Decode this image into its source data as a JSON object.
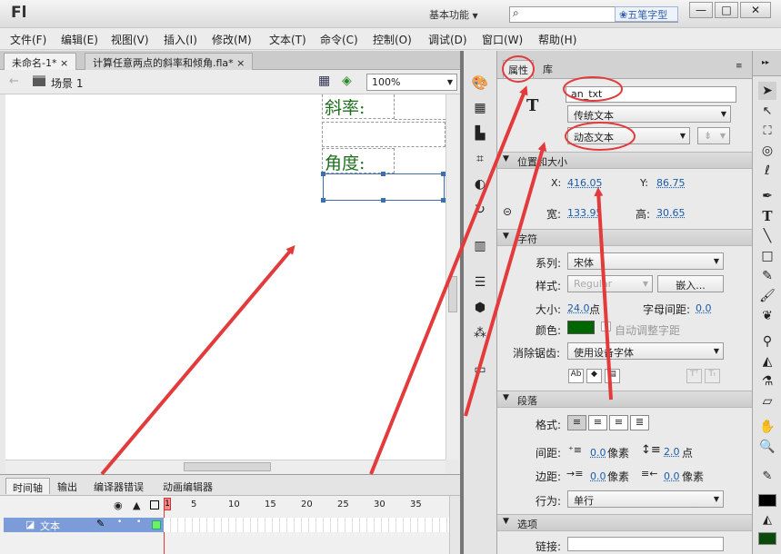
{
  "app": {
    "logo": "Fl",
    "workspace": "基本功能",
    "ime": "五笔字型",
    "win_min": "—",
    "win_max": "□",
    "win_close": "✕"
  },
  "menu": [
    "文件(F)",
    "编辑(E)",
    "视图(V)",
    "插入(I)",
    "修改(M)",
    "文本(T)",
    "命令(C)",
    "控制(O)",
    "调试(D)",
    "窗口(W)",
    "帮助(H)"
  ],
  "doc_tabs": [
    {
      "label": "未命名-1*",
      "close": "×"
    },
    {
      "label": "计算任意两点的斜率和倾角.fla*",
      "close": "×"
    }
  ],
  "scene": {
    "name": "场景 1",
    "zoom": "100%"
  },
  "stage": {
    "label1": "斜率:",
    "label2": "角度:"
  },
  "timeline": {
    "tabs": [
      "时间轴",
      "输出",
      "编译器错误",
      "动画编辑器"
    ],
    "frames": [
      "1",
      "5",
      "10",
      "15",
      "20",
      "25",
      "30",
      "35"
    ],
    "layer": "文本"
  },
  "props": {
    "tab_props": "属性",
    "tab_lib": "库",
    "type_icon": "T",
    "instance_name": "an_txt",
    "engine": "传统文本",
    "text_type": "动态文本",
    "sec_pos": "位置和大小",
    "x_label": "X:",
    "x_val": "416.05",
    "y_label": "Y:",
    "y_val": "86.75",
    "w_label": "宽:",
    "w_val": "133.95",
    "h_label": "高:",
    "h_val": "30.65",
    "sec_char": "字符",
    "family_label": "系列:",
    "family": "宋体",
    "style_label": "样式:",
    "style": "Regular",
    "embed": "嵌入...",
    "size_label": "大小:",
    "size": "24.0",
    "size_unit": "点",
    "spacing_label": "字母间距:",
    "spacing": "0.0",
    "color_label": "颜色:",
    "color": "#006600",
    "auto_kern": "自动调整字距",
    "aa_label": "消除锯齿:",
    "aa": "使用设备字体",
    "sec_para": "段落",
    "format_label": "格式:",
    "gap_label": "间距:",
    "indent": "0.0",
    "indent_unit": "像素",
    "line_spacing": "2.0",
    "line_unit": "点",
    "margin_label": "边距:",
    "left_margin": "0.0",
    "left_unit": "像素",
    "right_margin": "0.0",
    "right_unit": "像素",
    "behavior_label": "行为:",
    "behavior": "单行",
    "sec_opt": "选项",
    "link_label": "链接:"
  },
  "colors": {
    "annotation": "#e33b3b",
    "text_color": "#006600",
    "stroke": "#000000",
    "fill": "#0a4a0a"
  }
}
